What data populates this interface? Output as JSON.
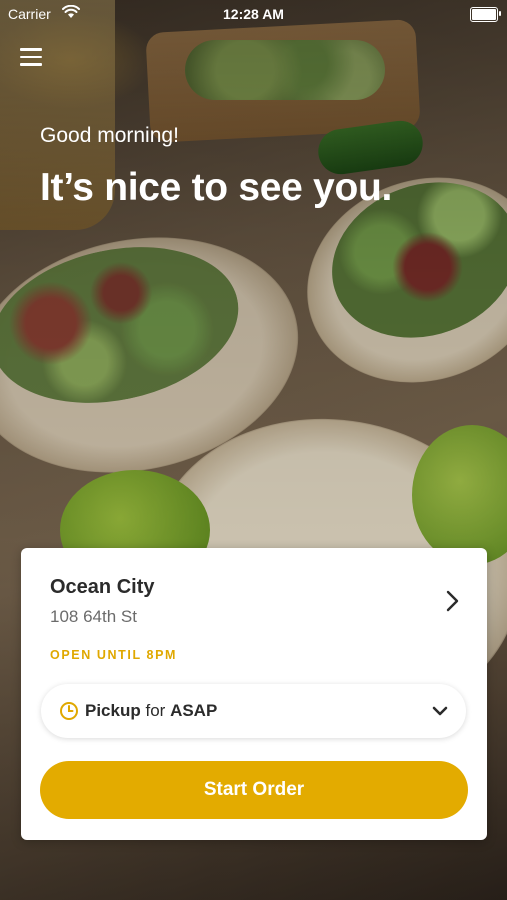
{
  "status_bar": {
    "carrier": "Carrier",
    "time": "12:28 AM"
  },
  "header": {
    "greeting": "Good morning!",
    "headline": "It’s nice to see you."
  },
  "location": {
    "name": "Ocean City",
    "address": "108 64th St",
    "hours": "OPEN UNTIL 8PM"
  },
  "order_mode": {
    "mode": "Pickup",
    "connector": "for",
    "time": "ASAP"
  },
  "actions": {
    "start_order": "Start Order"
  },
  "colors": {
    "accent": "#e3ab00",
    "hours_text": "#e0a800"
  },
  "icons": [
    "menu-icon",
    "wifi-icon",
    "battery-icon",
    "chevron-right-icon",
    "clock-icon",
    "chevron-down-icon"
  ]
}
